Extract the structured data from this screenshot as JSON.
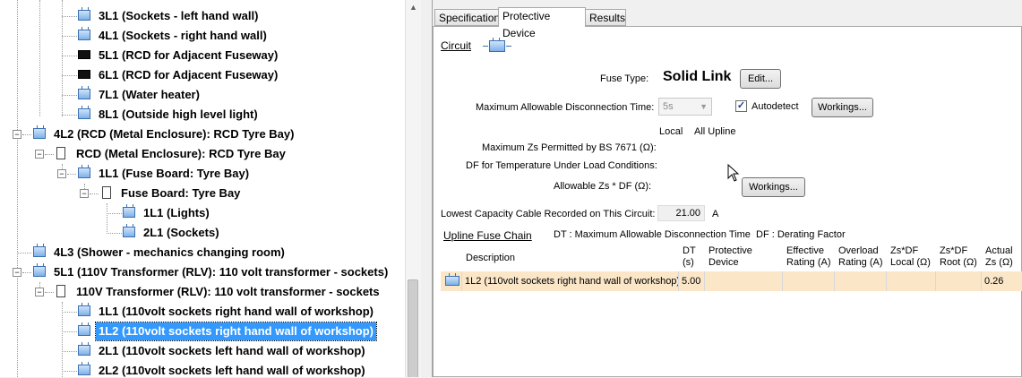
{
  "tree": {
    "items": [
      {
        "label": "3L1 (Sockets - left hand wall)"
      },
      {
        "label": "4L1 (Sockets - right hand wall)"
      },
      {
        "label": "5L1 (RCD for Adjacent Fuseway)"
      },
      {
        "label": "6L1 (RCD for Adjacent Fuseway)"
      },
      {
        "label": "7L1 (Water heater)"
      },
      {
        "label": "8L1 (Outside high level light)"
      },
      {
        "label": "4L2 (RCD (Metal Enclosure): RCD Tyre Bay)"
      },
      {
        "label": "RCD (Metal Enclosure): RCD Tyre Bay"
      },
      {
        "label": "1L1 (Fuse Board: Tyre Bay)"
      },
      {
        "label": "Fuse Board: Tyre Bay"
      },
      {
        "label": "1L1 (Lights)"
      },
      {
        "label": "2L1 (Sockets)"
      },
      {
        "label": "4L3 (Shower - mechanics changing room)"
      },
      {
        "label": "5L1 (110V Transformer (RLV): 110 volt transformer - sockets)"
      },
      {
        "label": "110V Transformer (RLV): 110 volt transformer - sockets"
      },
      {
        "label": "1L1 (110volt sockets right hand wall of workshop)"
      },
      {
        "label": "1L2 (110volt sockets right hand wall of workshop)"
      },
      {
        "label": "2L1 (110volt sockets left hand wall of workshop)"
      },
      {
        "label": "2L2 (110volt sockets left hand wall of workshop)"
      }
    ],
    "toggle_minus": "−",
    "toggle_plus": "+"
  },
  "tabs": [
    "Specification",
    "Protective Device",
    "Results"
  ],
  "form": {
    "circuit_label": "Circuit",
    "fuse_type_label": "Fuse Type:",
    "fuse_type_value": "Solid Link",
    "edit_button": "Edit...",
    "max_disconnect_label": "Maximum Allowable Disconnection Time:",
    "max_disconnect_value": "5s",
    "autodetect_label": "Autodetect",
    "autodetect_checked": "✓",
    "workings_button": "Workings...",
    "col_local": "Local",
    "col_all_upline": "All Upline",
    "max_zs_label": "Maximum Zs Permitted by BS 7671 (Ω):",
    "df_label": "DF for Temperature Under Load Conditions:",
    "allowable_zs_label": "Allowable Zs * DF (Ω):",
    "workings_button_2": "Workings...",
    "lowest_cable_label": "Lowest Capacity Cable Recorded on This Circuit:",
    "lowest_cable_value": "21.00",
    "lowest_cable_unit": "A"
  },
  "upline": {
    "title": "Upline Fuse Chain",
    "legend_dt": "DT : Maximum Allowable Disconnection Time",
    "legend_df": "DF : Derating Factor",
    "headers": [
      "Description",
      "DT\n(s)",
      "Protective\nDevice",
      "Effective\nRating (A)",
      "Overload\nRating (A)",
      "Zs*DF\nLocal (Ω)",
      "Zs*DF\nRoot (Ω)",
      "Actual\nZs (Ω)"
    ],
    "rows": [
      [
        "1L2 (110volt sockets right hand wall of workshop)",
        "5.00",
        "",
        "",
        "",
        "",
        "",
        "0.26"
      ]
    ]
  }
}
